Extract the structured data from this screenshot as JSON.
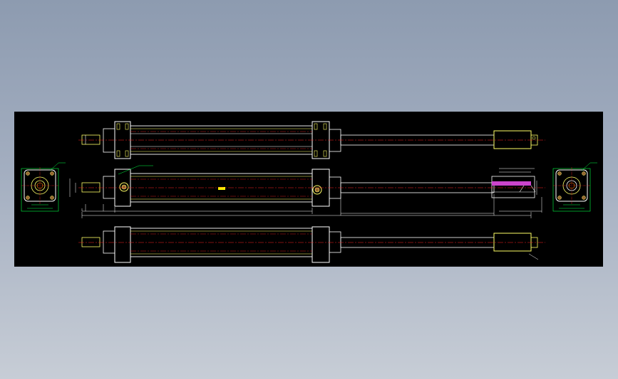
{
  "viewer": {
    "background_top": "#8d9bb0",
    "background_bottom": "#c7cdd6",
    "canvas_color": "#000000"
  },
  "drawing": {
    "title_lines": [
      "",
      ""
    ],
    "colors": {
      "outline": "#ffffff",
      "outline_yellow": "#ffff66",
      "centerline": "#ff2222",
      "dimension": "#00ff44",
      "hatch": "#cc44cc"
    },
    "views": [
      {
        "name": "top-view"
      },
      {
        "name": "middle-view"
      },
      {
        "name": "bottom-view"
      }
    ],
    "end_views": [
      {
        "name": "left-end-view"
      },
      {
        "name": "right-end-view"
      }
    ]
  }
}
